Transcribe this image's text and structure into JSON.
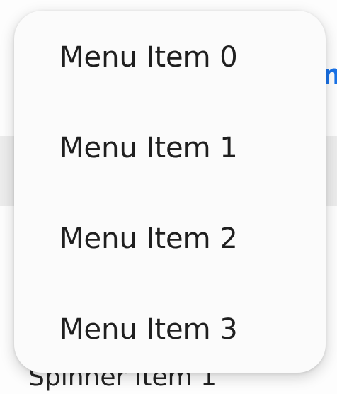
{
  "background": {
    "link_fragment": "n",
    "spinner_item": "Spinner Item 1"
  },
  "menu": {
    "items": [
      {
        "label": "Menu Item 0"
      },
      {
        "label": "Menu Item 1"
      },
      {
        "label": "Menu Item 2"
      },
      {
        "label": "Menu Item 3"
      }
    ]
  },
  "colors": {
    "menu_background": "#fbfbfb",
    "menu_text": "#1f1f1f",
    "link_accent": "#1a73e8",
    "band_gray": "#ececec"
  }
}
